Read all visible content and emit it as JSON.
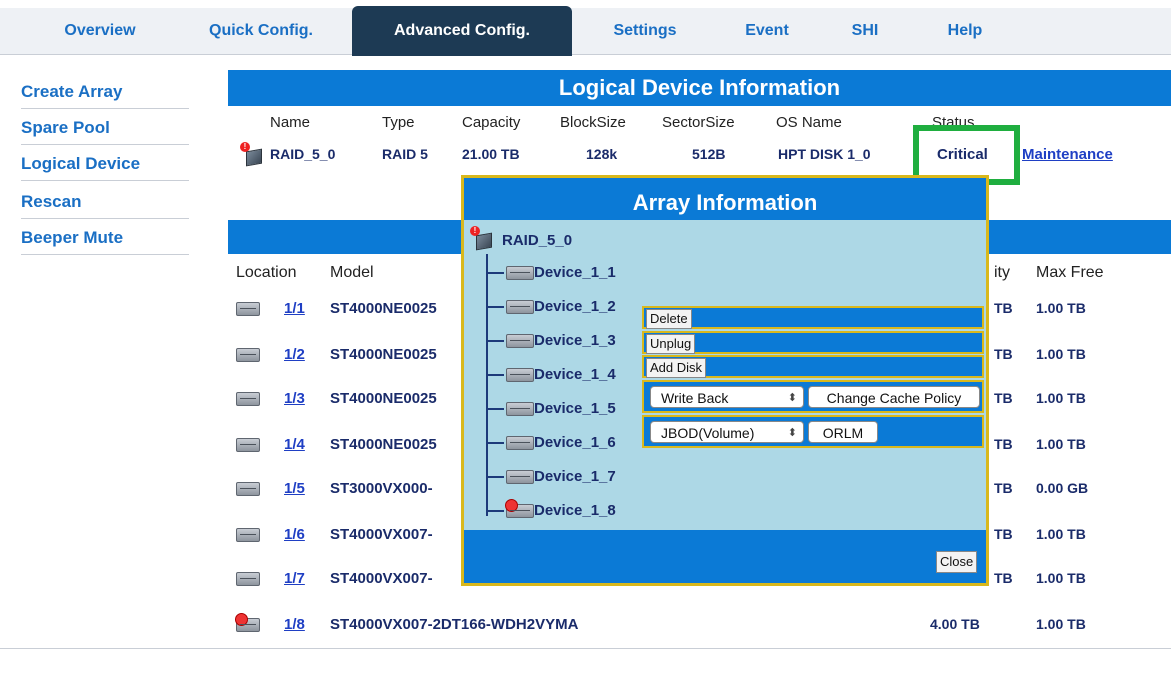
{
  "nav": {
    "tabs": [
      {
        "label": "Overview"
      },
      {
        "label": "Quick Config."
      },
      {
        "label": "Advanced Config."
      },
      {
        "label": "Settings"
      },
      {
        "label": "Event"
      },
      {
        "label": "SHI"
      },
      {
        "label": "Help"
      }
    ],
    "active_tab": "Advanced Config."
  },
  "sidebar": {
    "items": [
      {
        "label": "Create Array"
      },
      {
        "label": "Spare Pool"
      },
      {
        "label": "Logical Device"
      },
      {
        "label": "Rescan"
      },
      {
        "label": "Beeper Mute"
      }
    ]
  },
  "logical": {
    "title": "Logical Device Information",
    "headers": {
      "name": "Name",
      "type": "Type",
      "capacity": "Capacity",
      "blocksize": "BlockSize",
      "sectorsize": "SectorSize",
      "osname": "OS Name",
      "status": "Status"
    },
    "row": {
      "name": "RAID_5_0",
      "type": "RAID 5",
      "capacity": "21.00 TB",
      "blocksize": "128k",
      "sectorsize": "512B",
      "osname": "HPT DISK 1_0",
      "status": "Critical",
      "action": "Maintenance"
    }
  },
  "physical": {
    "headers": {
      "location": "Location",
      "model": "Model",
      "capacity_tail": "ity",
      "maxfree": "Max Free"
    },
    "rows": [
      {
        "loc": "1/1",
        "model": "ST4000NE0025",
        "cap": "TB",
        "free": "1.00 TB"
      },
      {
        "loc": "1/2",
        "model": "ST4000NE0025",
        "cap": "TB",
        "free": "1.00 TB"
      },
      {
        "loc": "1/3",
        "model": "ST4000NE0025",
        "cap": "TB",
        "free": "1.00 TB"
      },
      {
        "loc": "1/4",
        "model": "ST4000NE0025",
        "cap": "TB",
        "free": "1.00 TB"
      },
      {
        "loc": "1/5",
        "model": "ST3000VX000-",
        "cap": "TB",
        "free": "0.00 GB"
      },
      {
        "loc": "1/6",
        "model": "ST4000VX007-",
        "cap": "TB",
        "free": "1.00 TB"
      },
      {
        "loc": "1/7",
        "model": "ST4000VX007-",
        "cap": "TB",
        "free": "1.00 TB"
      },
      {
        "loc": "1/8",
        "model": "ST4000VX007-2DT166-WDH2VYMA",
        "cap": "4.00 TB",
        "free": "1.00 TB"
      }
    ]
  },
  "popup": {
    "title": "Array Information",
    "array_name": "RAID_5_0",
    "devices": [
      "Device_1_1",
      "Device_1_2",
      "Device_1_3",
      "Device_1_4",
      "Device_1_5",
      "Device_1_6",
      "Device_1_7",
      "Device_1_8"
    ],
    "actions": {
      "delete": "Delete",
      "unplug": "Unplug",
      "add_disk": "Add Disk",
      "cache_select": "Write Back",
      "change_cache": "Change Cache Policy",
      "orlm_select": "JBOD(Volume)",
      "orlm": "ORLM"
    },
    "close": "Close"
  },
  "colors": {
    "accent_blue": "#0b7ad6",
    "highlight_green": "#1fae3f",
    "popup_bg": "#add8e6",
    "popup_border": "#d9b81c"
  }
}
